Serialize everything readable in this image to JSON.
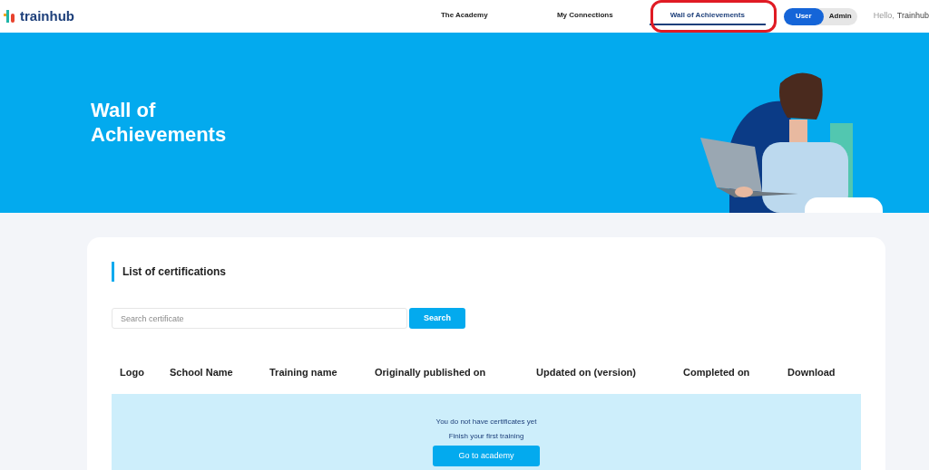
{
  "brand": {
    "name": "trainhub"
  },
  "nav": [
    {
      "label": "The Academy",
      "selected": false
    },
    {
      "label": "My Connections",
      "selected": false
    },
    {
      "label": "Wall of Achievements",
      "selected": true
    }
  ],
  "role_toggle": [
    {
      "label": "User",
      "selected": true
    },
    {
      "label": "Admin",
      "selected": false
    }
  ],
  "greeting": {
    "text": "Hello,",
    "name": "Trainhub"
  },
  "hero": {
    "title": "Wall of Achievements",
    "kind": "picture"
  },
  "section_title": "List of certifications",
  "search": {
    "placeholder": "Search certificate",
    "button": "Search"
  },
  "table": {
    "columns": [
      "Logo",
      "School Name",
      "Training name",
      "Originally published on",
      "Updated on (version)",
      "Completed on",
      "Download"
    ]
  },
  "empty_state": {
    "lines": [
      "You do not have certificates yet",
      "Finish your first training"
    ],
    "button": "Go to academy"
  }
}
